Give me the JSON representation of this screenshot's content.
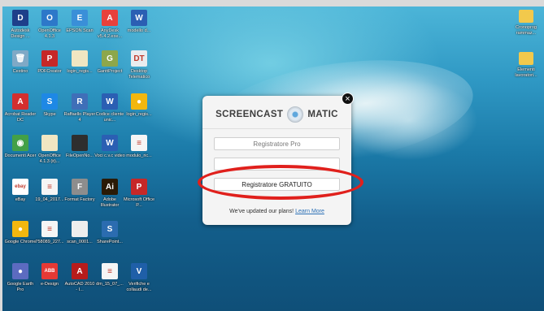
{
  "desktop": {
    "icons": [
      {
        "label": "Autodesk Design ...",
        "icon": "autodesk-design-review-icon",
        "color": "#1e3f8a",
        "glyph": "D",
        "col": 0,
        "row": 0
      },
      {
        "label": "OpenOffice 4.1.3",
        "icon": "openoffice-icon",
        "color": "#2d78c9",
        "glyph": "O",
        "col": 1,
        "row": 0
      },
      {
        "label": "EPSON Scan",
        "icon": "epson-scan-icon",
        "color": "#3a8fd8",
        "glyph": "E",
        "col": 2,
        "row": 0
      },
      {
        "label": "AnyDesk v5.4.2.exe...",
        "icon": "anydesk-icon",
        "color": "#e8413b",
        "glyph": "A",
        "col": 3,
        "row": 0
      },
      {
        "label": "modello d...",
        "icon": "word-document-icon",
        "color": "#2b5fb3",
        "glyph": "W",
        "col": 4,
        "row": 0
      },
      {
        "label": "Cestino",
        "icon": "recycle-bin-icon",
        "color": "#7fa9c6",
        "glyph": "🗑",
        "col": 0,
        "row": 1
      },
      {
        "label": "PDFCreator",
        "icon": "pdfcreator-icon",
        "color": "#c62828",
        "glyph": "P",
        "col": 1,
        "row": 1
      },
      {
        "label": "login_regis...",
        "icon": "file-icon",
        "color": "#f0e6c2",
        "glyph": "",
        "col": 2,
        "row": 1
      },
      {
        "label": "GanttProject",
        "icon": "ganttproject-icon",
        "color": "#8da74b",
        "glyph": "G",
        "col": 3,
        "row": 1
      },
      {
        "label": "Desktop Telematico",
        "icon": "desktop-telematico-icon",
        "color": "#e9ecef",
        "glyph": "DT",
        "col": 4,
        "row": 1
      },
      {
        "label": "Acrobat Reader DC",
        "icon": "acrobat-reader-icon",
        "color": "#d32f2f",
        "glyph": "A",
        "col": 0,
        "row": 2
      },
      {
        "label": "Skype",
        "icon": "skype-icon",
        "color": "#1e88e5",
        "glyph": "S",
        "col": 1,
        "row": 2
      },
      {
        "label": "Raffaello Player 4",
        "icon": "raffaello-player-icon",
        "color": "#3f6fb8",
        "glyph": "R",
        "col": 2,
        "row": 2
      },
      {
        "label": "Codice cliente unic...",
        "icon": "word-document-icon",
        "color": "#2b5fb3",
        "glyph": "W",
        "col": 3,
        "row": 2
      },
      {
        "label": "login_regis...",
        "icon": "chrome-icon",
        "color": "#f2b70f",
        "glyph": "●",
        "col": 4,
        "row": 2
      },
      {
        "label": "Documenti Acer",
        "icon": "documenti-acer-icon",
        "color": "#43a047",
        "glyph": "◉",
        "col": 0,
        "row": 3
      },
      {
        "label": "OpenOffice 4.1.3 (it)...",
        "icon": "file-icon",
        "color": "#f0e6c2",
        "glyph": "",
        "col": 1,
        "row": 3
      },
      {
        "label": "FileOpenNo...",
        "icon": "fileopen-icon",
        "color": "#2e2e2e",
        "glyph": "",
        "col": 2,
        "row": 3
      },
      {
        "label": "Voci c.v.c video",
        "icon": "word-document-icon",
        "color": "#2b5fb3",
        "glyph": "W",
        "col": 3,
        "row": 3
      },
      {
        "label": "modulo_ric...",
        "icon": "pdf-file-icon",
        "color": "#f5f5f5",
        "glyph": "≡",
        "col": 4,
        "row": 3
      },
      {
        "label": "eBay",
        "icon": "ebay-icon",
        "color": "#ffffff",
        "glyph": "ebay",
        "col": 0,
        "row": 4
      },
      {
        "label": "19_04_2017...",
        "icon": "pdf-file-icon",
        "color": "#f5f5f5",
        "glyph": "≡",
        "col": 1,
        "row": 4
      },
      {
        "label": "Format Factory",
        "icon": "format-factory-icon",
        "color": "#8d8d8d",
        "glyph": "F",
        "col": 2,
        "row": 4
      },
      {
        "label": "Adobe Illustrator",
        "icon": "adobe-illustrator-icon",
        "color": "#2a1a05",
        "glyph": "Ai",
        "col": 3,
        "row": 4
      },
      {
        "label": "Microsoft Office P...",
        "icon": "office-picture-icon",
        "color": "#c62828",
        "glyph": "P",
        "col": 4,
        "row": 4
      },
      {
        "label": "Google Chrome",
        "icon": "chrome-icon",
        "color": "#f2b70f",
        "glyph": "●",
        "col": 0,
        "row": 5
      },
      {
        "label": "758089_227...",
        "icon": "pdf-file-icon",
        "color": "#f5f5f5",
        "glyph": "≡",
        "col": 1,
        "row": 5
      },
      {
        "label": "scan_0001...",
        "icon": "file-icon",
        "color": "#eeeeee",
        "glyph": "",
        "col": 2,
        "row": 5
      },
      {
        "label": "SharePoint...",
        "icon": "sharepoint-icon",
        "color": "#2b6cb0",
        "glyph": "S",
        "col": 3,
        "row": 5
      },
      {
        "label": "Google Earth Pro",
        "icon": "google-earth-icon",
        "color": "#5c6bc0",
        "glyph": "●",
        "col": 0,
        "row": 6
      },
      {
        "label": "e-Design",
        "icon": "abb-edesign-icon",
        "color": "#e53935",
        "glyph": "ABB",
        "col": 1,
        "row": 6
      },
      {
        "label": "AutoCAD 2010 - I...",
        "icon": "autocad-icon",
        "color": "#b71c1c",
        "glyph": "A",
        "col": 2,
        "row": 6
      },
      {
        "label": "dm_15_07_...",
        "icon": "pdf-file-icon",
        "color": "#f5f5f5",
        "glyph": "≡",
        "col": 3,
        "row": 6
      },
      {
        "label": "Verifiche e collaudi de...",
        "icon": "verifiche-icon",
        "color": "#1f5fa8",
        "glyph": "V",
        "col": 4,
        "row": 6
      }
    ],
    "right_icons": [
      {
        "label": "Cronoprog rammaz...",
        "icon": "folder-icon"
      },
      {
        "label": "Elementi lavoratori...",
        "icon": "folder-icon"
      }
    ]
  },
  "dialog": {
    "brand_left": "SCREENCAST",
    "brand_right": "MATIC",
    "close_glyph": "×",
    "pro_button": "Registratore Pro",
    "free_button": "Registratore GRATUITO",
    "notice_text": "We've updated our plans!",
    "notice_link": "Learn More"
  },
  "annotation": {
    "color": "#e0201c",
    "shape": "ellipse"
  }
}
